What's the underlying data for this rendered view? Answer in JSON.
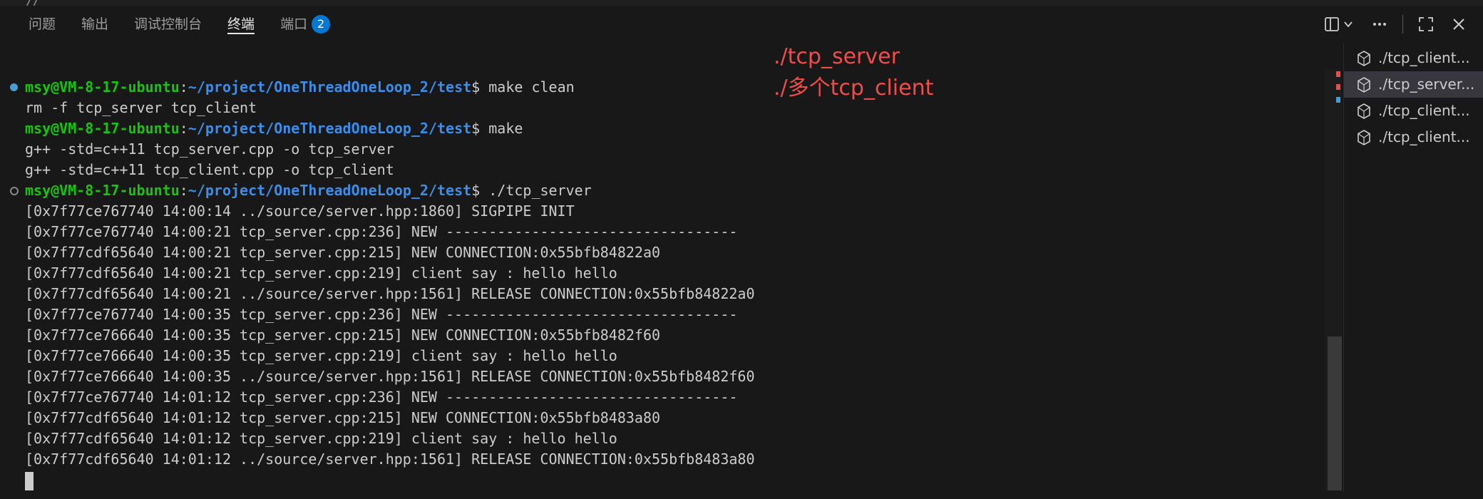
{
  "panel": {
    "tabs": [
      {
        "label": "问题"
      },
      {
        "label": "输出"
      },
      {
        "label": "调试控制台"
      },
      {
        "label": "终端"
      },
      {
        "label": "端口",
        "badge": "2"
      }
    ]
  },
  "annotation": {
    "line1": "./tcp_server",
    "line2": "./多个tcp_client"
  },
  "terminal": {
    "prompt_user": "msy@VM-8-17-ubuntu",
    "prompt_path": "~/project/OneThreadOneLoop_2/test",
    "cmd1": " make clean",
    "out1": "rm -f tcp_server tcp_client",
    "cmd2": " make",
    "out2": "g++ -std=c++11 tcp_server.cpp -o tcp_server",
    "out3": "g++ -std=c++11 tcp_client.cpp -o tcp_client",
    "cmd3": " ./tcp_server",
    "log": [
      "[0x7f77ce767740 14:00:14 ../source/server.hpp:1860] SIGPIPE INIT",
      "[0x7f77ce767740 14:00:21 tcp_server.cpp:236] NEW ----------------------------------",
      "[0x7f77cdf65640 14:00:21 tcp_server.cpp:215] NEW CONNECTION:0x55bfb84822a0",
      "[0x7f77cdf65640 14:00:21 tcp_server.cpp:219] client say : hello hello",
      "[0x7f77cdf65640 14:00:21 ../source/server.hpp:1561] RELEASE CONNECTION:0x55bfb84822a0",
      "[0x7f77ce767740 14:00:35 tcp_server.cpp:236] NEW ----------------------------------",
      "[0x7f77ce766640 14:00:35 tcp_server.cpp:215] NEW CONNECTION:0x55bfb8482f60",
      "[0x7f77ce766640 14:00:35 tcp_server.cpp:219] client say : hello hello",
      "[0x7f77ce766640 14:00:35 ../source/server.hpp:1561] RELEASE CONNECTION:0x55bfb8482f60",
      "[0x7f77ce767740 14:01:12 tcp_server.cpp:236] NEW ----------------------------------",
      "[0x7f77cdf65640 14:01:12 tcp_server.cpp:215] NEW CONNECTION:0x55bfb8483a80",
      "[0x7f77cdf65640 14:01:12 tcp_server.cpp:219] client say : hello hello",
      "[0x7f77cdf65640 14:01:12 ../source/server.hpp:1561] RELEASE CONNECTION:0x55bfb8483a80"
    ]
  },
  "terminal_list": [
    {
      "label": "./tcp_client...",
      "selected": false
    },
    {
      "label": "./tcp_server...",
      "selected": true
    },
    {
      "label": "./tcp_client...",
      "selected": false
    },
    {
      "label": "./tcp_client...",
      "selected": false
    }
  ],
  "icons": {
    "split": "split-terminal-icon",
    "chevron": "chevron-down-icon",
    "more": "more-actions-icon",
    "maximize": "maximize-panel-icon",
    "close": "close-panel-icon",
    "terminal": "terminal-icon"
  },
  "colors": {
    "user": "#16c60c",
    "path": "#3b8eea",
    "annotation": "#f14c4c",
    "badge": "#0078d4"
  }
}
